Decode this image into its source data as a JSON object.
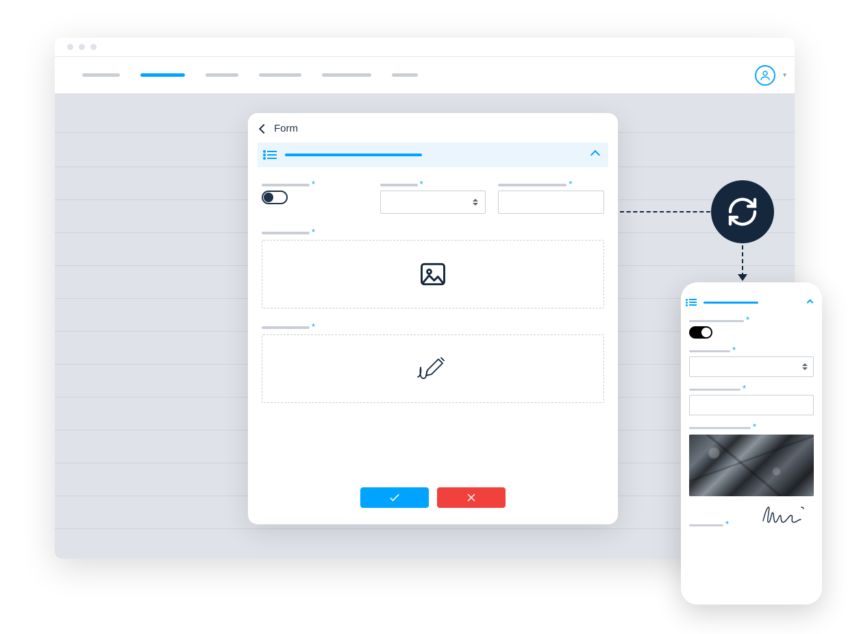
{
  "form": {
    "title": "Form",
    "colors": {
      "accent": "#00a3ff",
      "danger": "#f1413d",
      "dark": "#14273d"
    }
  },
  "icons": {
    "back": "chevron-left",
    "list": "list",
    "collapse": "chevron-up",
    "image": "image",
    "signature": "signature",
    "confirm": "check",
    "cancel": "x",
    "sync": "refresh",
    "selectCaret": "sort",
    "avatar": "user"
  }
}
